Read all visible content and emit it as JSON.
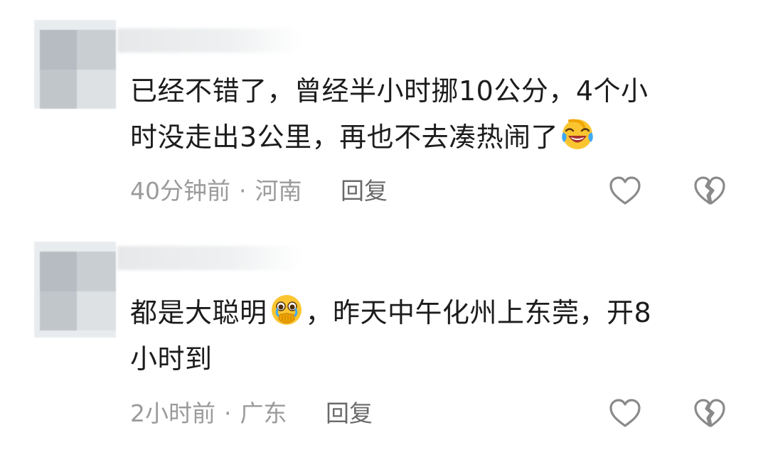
{
  "comments": [
    {
      "line1": "已经不错了，曾经半小时挪10公分，4个小",
      "line2": "时没走出3公里，再也不去凑热闹了",
      "emoji": "laughing-crying-face-icon",
      "time": "40分钟前",
      "separator": "·",
      "location": "河南",
      "reply_label": "回复"
    },
    {
      "line1_before": "都是大聪明",
      "line1_after": "，昨天中午化州上东莞，开8",
      "line2": "小时到",
      "emoji": "holding-back-tears-face-icon",
      "time": "2小时前",
      "separator": "·",
      "location": "广东",
      "reply_label": "回复"
    }
  ],
  "colors": {
    "text": "#1c1c1c",
    "meta": "#9b9b9b",
    "reply": "#6a6a6a",
    "icon": "#8a8a8a"
  }
}
